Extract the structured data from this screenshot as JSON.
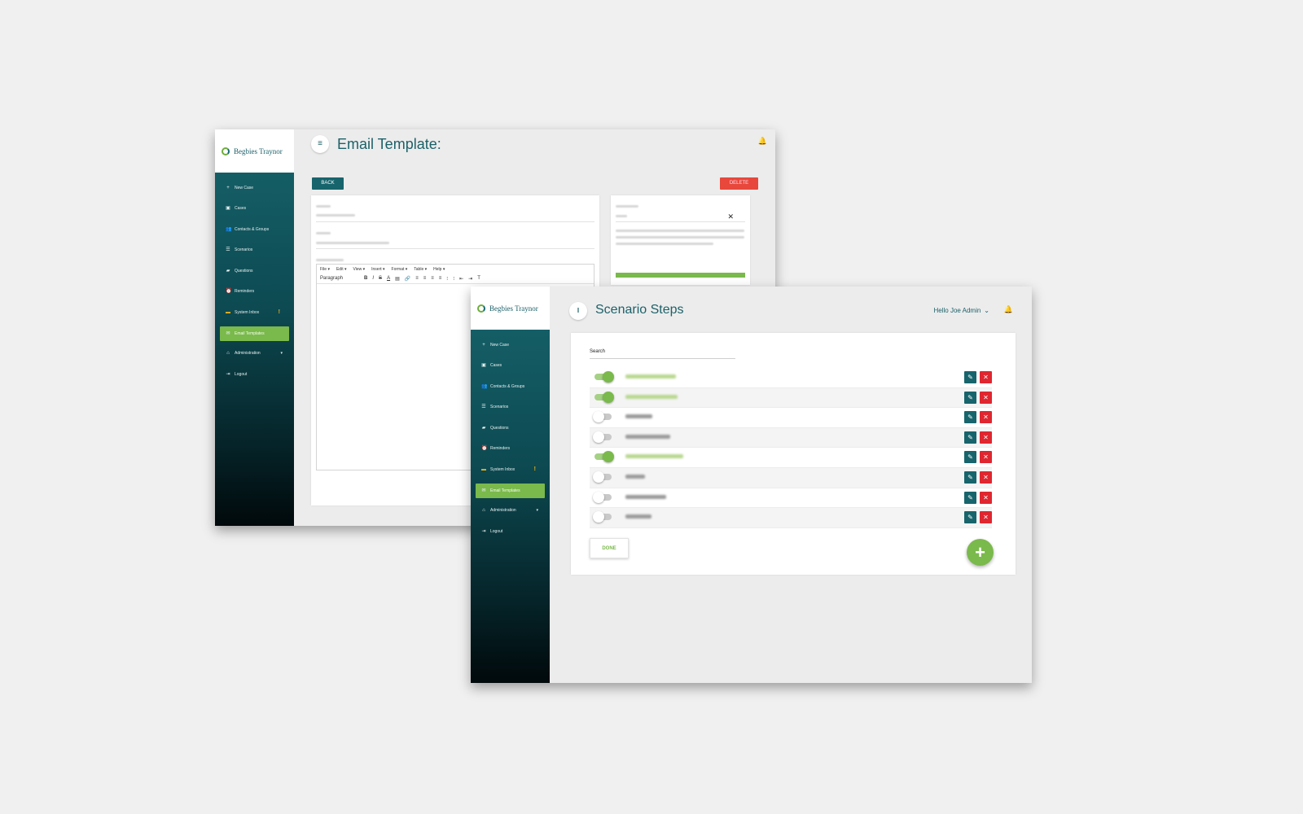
{
  "brand": {
    "logo_text": "Begbies Traynor",
    "accent": "#7ab94b",
    "primary": "#17646c",
    "danger": "#e0262f"
  },
  "sidebar": {
    "items": [
      {
        "label": "New Case",
        "icon": "plus-icon"
      },
      {
        "label": "Cases",
        "icon": "case-icon"
      },
      {
        "label": "Contacts & Groups",
        "icon": "people-icon"
      },
      {
        "label": "Scenarios",
        "icon": "list-icon"
      },
      {
        "label": "Questions",
        "icon": "chat-icon"
      },
      {
        "label": "Reminders",
        "icon": "alarm-icon"
      },
      {
        "label": "System Inbox",
        "icon": "inbox-icon",
        "badge": "!"
      },
      {
        "label": "Email Templates",
        "icon": "mail-icon",
        "active": true
      },
      {
        "label": "Administration",
        "icon": "admin-icon",
        "caret": "▾"
      },
      {
        "label": "Logout",
        "icon": "logout-icon"
      }
    ]
  },
  "email_template": {
    "title": "Email Template:",
    "back_label": "BACK",
    "delete_label": "DELETE",
    "editor_menu": [
      "File ▾",
      "Edit ▾",
      "View ▾",
      "Insert ▾",
      "Format ▾",
      "Table ▾",
      "Help ▾"
    ],
    "editor_format": "Paragraph",
    "close_symbol": "✕"
  },
  "scenario_steps": {
    "title": "Scenario Steps",
    "greeting": "Hello Joe Admin",
    "search_label": "Search",
    "done_label": "DONE",
    "add_symbol": "+",
    "steps": [
      {
        "enabled": true
      },
      {
        "enabled": true
      },
      {
        "enabled": false
      },
      {
        "enabled": false
      },
      {
        "enabled": true
      },
      {
        "enabled": false
      },
      {
        "enabled": false
      },
      {
        "enabled": false
      }
    ]
  }
}
